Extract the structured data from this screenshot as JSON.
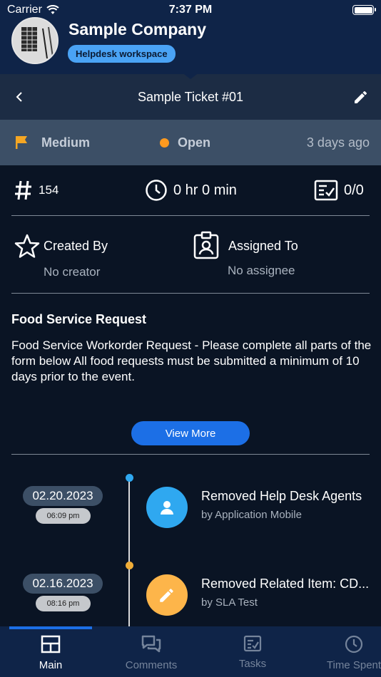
{
  "status_bar": {
    "carrier": "Carrier",
    "time": "7:37 PM"
  },
  "company": {
    "name": "Sample Company",
    "workspace": "Helpdesk workspace"
  },
  "nav": {
    "title": "Sample Ticket #01"
  },
  "meta": {
    "priority": "Medium",
    "status": "Open",
    "age": "3 days ago",
    "priority_color": "#f5a623",
    "status_color": "#ff9a1f"
  },
  "stats": {
    "number": "154",
    "time_spent": "0 hr 0 min",
    "tasks": "0/0"
  },
  "people": {
    "created_by_label": "Created By",
    "created_by_value": "No creator",
    "assigned_to_label": "Assigned To",
    "assigned_to_value": "No assignee"
  },
  "description": {
    "title": "Food Service Request",
    "body": "Food Service Workorder Request - Please complete all parts of the form below All food requests must be submitted a minimum of 10 days prior to the event.",
    "view_more": "View More"
  },
  "timeline": [
    {
      "date": "02.20.2023",
      "time": "06:09 pm",
      "title": "Removed Help Desk Agents",
      "subtitle": "by Application Mobile",
      "icon": "user-icon",
      "color": "#2fa8f0",
      "dot_color": "#2fa8f0"
    },
    {
      "date": "02.16.2023",
      "time": "08:16 pm",
      "title": "Removed Related Item: CD...",
      "subtitle": "by SLA Test",
      "icon": "pencil-icon",
      "color": "#fdb54a",
      "dot_color": "#f0ad38"
    }
  ],
  "tabs": [
    {
      "label": "Main",
      "icon": "main-layout-icon",
      "active": true
    },
    {
      "label": "Comments",
      "icon": "comments-icon",
      "active": false
    },
    {
      "label": "Tasks",
      "icon": "tasks-icon",
      "active": false
    },
    {
      "label": "Time Spent",
      "icon": "clock-icon",
      "active": false
    }
  ]
}
